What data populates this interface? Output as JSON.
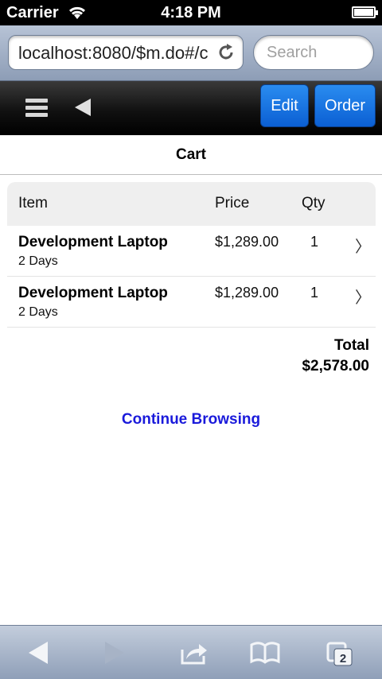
{
  "status_bar": {
    "carrier": "Carrier",
    "time": "4:18 PM"
  },
  "browser": {
    "url": "localhost:8080/$m.do#/c",
    "search_placeholder": "Search",
    "tab_count": "2"
  },
  "header": {
    "edit_label": "Edit",
    "order_label": "Order"
  },
  "page": {
    "title": "Cart"
  },
  "cart": {
    "columns": {
      "item": "Item",
      "price": "Price",
      "qty": "Qty"
    },
    "rows": [
      {
        "name": "Development Laptop",
        "duration": "2 Days",
        "price": "$1,289.00",
        "qty": "1",
        "chevron": "〉"
      },
      {
        "name": "Development Laptop",
        "duration": "2 Days",
        "price": "$1,289.00",
        "qty": "1",
        "chevron": "〉"
      }
    ],
    "total_label": "Total",
    "total_value": "$2,578.00"
  },
  "links": {
    "continue": "Continue Browsing"
  },
  "icons": {
    "wifi": "wifi-icon",
    "battery": "battery-icon",
    "reload": "reload-icon",
    "menu": "menu-icon",
    "back": "back-arrow-icon",
    "toolbar": [
      "back-icon",
      "forward-icon",
      "share-icon",
      "bookmarks-icon",
      "tabs-icon"
    ]
  },
  "colors": {
    "accent_button": "#1a73e8",
    "link": "#1a1adb",
    "header_bg": "#111111"
  }
}
